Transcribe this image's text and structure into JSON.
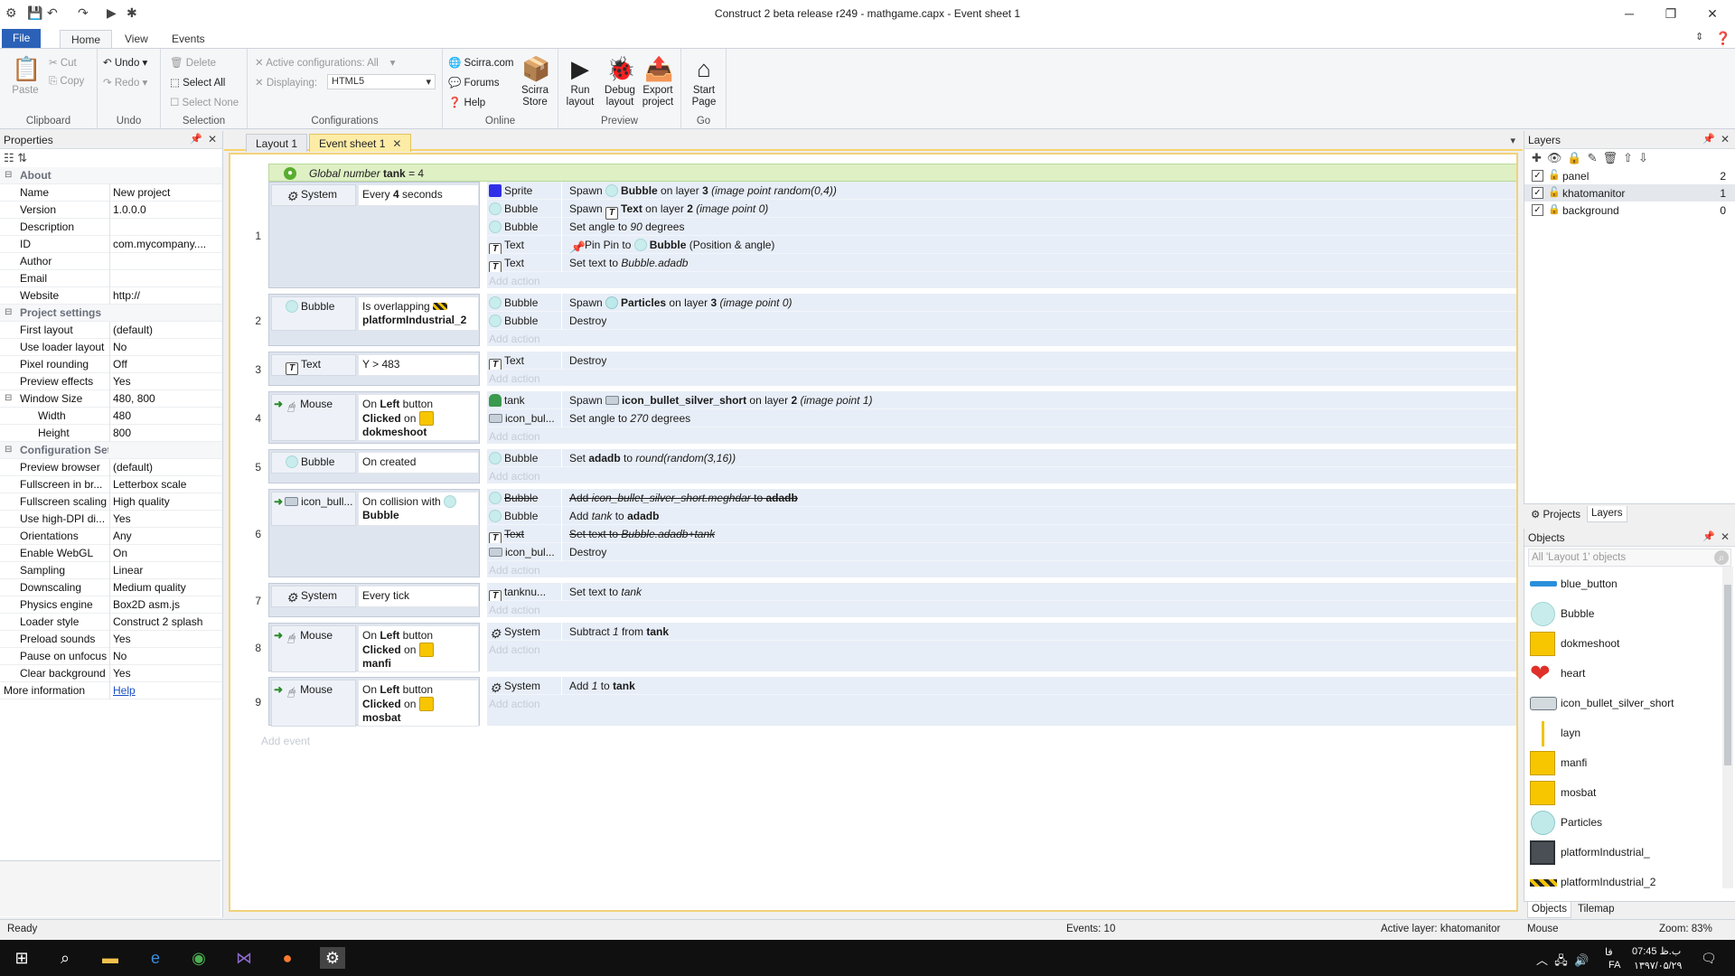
{
  "window": {
    "title": "Construct 2 beta release r249 - mathgame.capx - Event sheet 1",
    "min": "─",
    "max": "❐",
    "close": "✕"
  },
  "quick_access": [
    "💾",
    "↶",
    "↷",
    "▶",
    "✱"
  ],
  "ribbon": {
    "tabs": [
      "File",
      "Home",
      "View",
      "Events"
    ],
    "clipboard": {
      "paste": "Paste",
      "cut": "Cut",
      "copy": "Copy",
      "group": "Clipboard"
    },
    "undo": {
      "undo": "Undo",
      "redo": "Redo",
      "group": "Undo"
    },
    "selection": {
      "delete": "Delete",
      "select_all": "Select All",
      "select_none": "Select None",
      "group": "Selection"
    },
    "configurations": {
      "active": "Active configurations: All",
      "displaying_label": "Displaying:",
      "displaying_value": "HTML5",
      "group": "Configurations"
    },
    "online": {
      "scirra": "Scirra.com",
      "forums": "Forums",
      "help": "Help",
      "store_line1": "Scirra",
      "store_line2": "Store",
      "group": "Online"
    },
    "preview": {
      "run1": "Run",
      "run2": "layout",
      "debug1": "Debug",
      "debug2": "layout",
      "export1": "Export",
      "export2": "project",
      "group": "Preview"
    },
    "go": {
      "start1": "Start",
      "start2": "Page",
      "group": "Go"
    }
  },
  "properties": {
    "header": "Properties",
    "rows": [
      {
        "type": "cat",
        "k": "About"
      },
      {
        "k": "Name",
        "v": "New project"
      },
      {
        "k": "Version",
        "v": "1.0.0.0"
      },
      {
        "k": "Description",
        "v": ""
      },
      {
        "k": "ID",
        "v": "com.mycompany...."
      },
      {
        "k": "Author",
        "v": ""
      },
      {
        "k": "Email",
        "v": ""
      },
      {
        "k": "Website",
        "v": "http://"
      },
      {
        "type": "cat",
        "k": "Project settings"
      },
      {
        "k": "First layout",
        "v": "(default)"
      },
      {
        "k": "Use loader layout",
        "v": "No"
      },
      {
        "k": "Pixel rounding",
        "v": "Off"
      },
      {
        "k": "Preview effects",
        "v": "Yes"
      },
      {
        "type": "group",
        "k": "Window Size",
        "v": "480, 800"
      },
      {
        "type": "sub",
        "k": "Width",
        "v": "480"
      },
      {
        "type": "sub",
        "k": "Height",
        "v": "800"
      },
      {
        "type": "cat",
        "k": "Configuration Settings"
      },
      {
        "k": "Preview browser",
        "v": "(default)"
      },
      {
        "k": "Fullscreen in br...",
        "v": "Letterbox scale"
      },
      {
        "k": "Fullscreen scaling",
        "v": "High quality"
      },
      {
        "k": "Use high-DPI di...",
        "v": "Yes"
      },
      {
        "k": "Orientations",
        "v": "Any"
      },
      {
        "k": "Enable WebGL",
        "v": "On"
      },
      {
        "k": "Sampling",
        "v": "Linear"
      },
      {
        "k": "Downscaling",
        "v": "Medium quality"
      },
      {
        "k": "Physics engine",
        "v": "Box2D asm.js"
      },
      {
        "k": "Loader style",
        "v": "Construct 2 splash"
      },
      {
        "k": "Preload sounds",
        "v": "Yes"
      },
      {
        "k": "Pause on unfocus",
        "v": "No"
      },
      {
        "k": "Clear background",
        "v": "Yes"
      },
      {
        "type": "link",
        "k": "More information",
        "v": "Help"
      }
    ]
  },
  "doc_tabs": [
    "Layout 1",
    "Event sheet 1"
  ],
  "global_var": {
    "pre": "Global number ",
    "name": "tank",
    "post": " = 4"
  },
  "events": [
    {
      "num": "1",
      "conds": [
        {
          "icon": "gear",
          "obj": "System",
          "html": "Every <b>4</b> seconds"
        }
      ],
      "actions": [
        {
          "icon": "sprite",
          "obj": "Sprite",
          "html": "Spawn <i class='i bub'></i><b>Bubble</b> on layer <b>3</b> <i>(image point random(0,4))</i>"
        },
        {
          "icon": "bub",
          "obj": "Bubble",
          "html": "Spawn <i class='i txt'>T</i><b>Text</b> on layer <b>2</b> <i>(image point 0)</i>"
        },
        {
          "icon": "bub",
          "obj": "Bubble",
          "html": "Set angle to <i>90</i> degrees"
        },
        {
          "icon": "txt",
          "obj": "Text",
          "html": "<i class='i pin'>📌</i>Pin Pin to <i class='i bub'></i><b>Bubble</b> (Position &amp; angle)"
        },
        {
          "icon": "txt",
          "obj": "Text",
          "html": "Set text to <i>Bubble.adadb</i>"
        }
      ]
    },
    {
      "num": "2",
      "conds": [
        {
          "icon": "bub",
          "obj": "Bubble",
          "html": "Is overlapping <i class='i plat'></i><br><b>platformIndustrial_2</b>"
        }
      ],
      "actions": [
        {
          "icon": "bub",
          "obj": "Bubble",
          "html": "Spawn <i class='i part'></i><b>Particles</b> on layer <b>3</b> <i>(image point 0)</i>"
        },
        {
          "icon": "bub",
          "obj": "Bubble",
          "html": "Destroy"
        }
      ]
    },
    {
      "num": "3",
      "conds": [
        {
          "icon": "txt",
          "obj": "Text",
          "html": "Y &gt; 483"
        }
      ],
      "actions": [
        {
          "icon": "txt",
          "obj": "Text",
          "html": "Destroy"
        }
      ]
    },
    {
      "num": "4",
      "trigger": true,
      "conds": [
        {
          "icon": "mouse",
          "obj": "Mouse",
          "html": "On <b>Left</b> button<br><b>Clicked</b> on <i class='i yel'></i><br><b>dokmeshoot</b>"
        }
      ],
      "actions": [
        {
          "icon": "tank",
          "obj": "tank",
          "html": "Spawn <i class='i bullet'></i><b>icon_bullet_silver_short</b> on layer <b>2</b> <i>(image point 1)</i>"
        },
        {
          "icon": "bullet",
          "obj": "icon_bul...",
          "html": "Set angle to <i>270</i> degrees"
        }
      ]
    },
    {
      "num": "5",
      "conds": [
        {
          "icon": "bub",
          "obj": "Bubble",
          "html": "On created"
        }
      ],
      "actions": [
        {
          "icon": "bub",
          "obj": "Bubble",
          "html": "Set <b>adadb</b> to <i>round(random(3,16))</i>"
        }
      ]
    },
    {
      "num": "6",
      "trigger": true,
      "conds": [
        {
          "icon": "bullet",
          "obj": "icon_bull...",
          "html": "On collision with <i class='i bub'></i><br><b>Bubble</b>"
        }
      ],
      "actions": [
        {
          "icon": "bub",
          "obj": "Bubble",
          "strike": true,
          "html": "Add <i>icon_bullet_silver_short.meghdar</i> to <b>adadb</b>"
        },
        {
          "icon": "bub",
          "obj": "Bubble",
          "html": "Add <i>tank</i> to <b>adadb</b>"
        },
        {
          "icon": "txt",
          "obj": "Text",
          "strike": true,
          "html": "Set text to <i>Bubble.adadb+tank</i>"
        },
        {
          "icon": "bullet",
          "obj": "icon_bul...",
          "html": "Destroy"
        }
      ]
    },
    {
      "num": "7",
      "conds": [
        {
          "icon": "gear",
          "obj": "System",
          "html": "Every tick"
        }
      ],
      "actions": [
        {
          "icon": "txt",
          "obj": "tanknu...",
          "html": "Set text to <i>tank</i>"
        }
      ]
    },
    {
      "num": "8",
      "trigger": true,
      "conds": [
        {
          "icon": "mouse",
          "obj": "Mouse",
          "html": "On <b>Left</b> button<br><b>Clicked</b> on <i class='i yel'></i><br><b>manfi</b>"
        }
      ],
      "actions": [
        {
          "icon": "gear",
          "obj": "System",
          "html": "Subtract <i>1</i> from <b>tank</b>"
        }
      ]
    },
    {
      "num": "9",
      "trigger": true,
      "conds": [
        {
          "icon": "mouse",
          "obj": "Mouse",
          "html": "On <b>Left</b> button<br><b>Clicked</b> on <i class='i yel'></i><br><b>mosbat</b>"
        }
      ],
      "actions": [
        {
          "icon": "gear",
          "obj": "System",
          "html": "Add <i>1</i> to <b>tank</b>"
        }
      ]
    }
  ],
  "add_action": "Add action",
  "add_event": "Add event",
  "layers": {
    "header": "Layers",
    "items": [
      {
        "name": "panel",
        "num": "2"
      },
      {
        "name": "khatomanitor",
        "num": "1",
        "selected": true
      },
      {
        "name": "background",
        "num": "0"
      }
    ]
  },
  "right_tabs1": [
    "Projects",
    "Layers"
  ],
  "objects": {
    "header": "Objects",
    "search_placeholder": "All 'Layout 1' objects",
    "items": [
      {
        "name": "blue_button",
        "icon": "bluebtn"
      },
      {
        "name": "Bubble",
        "icon": "bubble"
      },
      {
        "name": "dokmeshoot",
        "icon": "yellow"
      },
      {
        "name": "heart",
        "icon": "heart"
      },
      {
        "name": "icon_bullet_silver_short",
        "icon": "bullet"
      },
      {
        "name": "layn",
        "icon": "line"
      },
      {
        "name": "manfi",
        "icon": "yellow"
      },
      {
        "name": "mosbat",
        "icon": "yellow"
      },
      {
        "name": "Particles",
        "icon": "particles"
      },
      {
        "name": "platformIndustrial_",
        "icon": "darkbox"
      },
      {
        "name": "platformIndustrial_2",
        "icon": "hazard"
      }
    ]
  },
  "right_tabs2": [
    "Objects",
    "Tilemap"
  ],
  "status": {
    "ready": "Ready",
    "events": "Events: 10",
    "active_layer": "Active layer: khatomanitor",
    "mouse": "Mouse",
    "zoom": "Zoom: 83%"
  },
  "taskbar": {
    "time": "07:45 ب.ظ",
    "date": "۱۳۹۷/۰۵/۲۹",
    "lang": "FA",
    "lang2": "فا"
  }
}
